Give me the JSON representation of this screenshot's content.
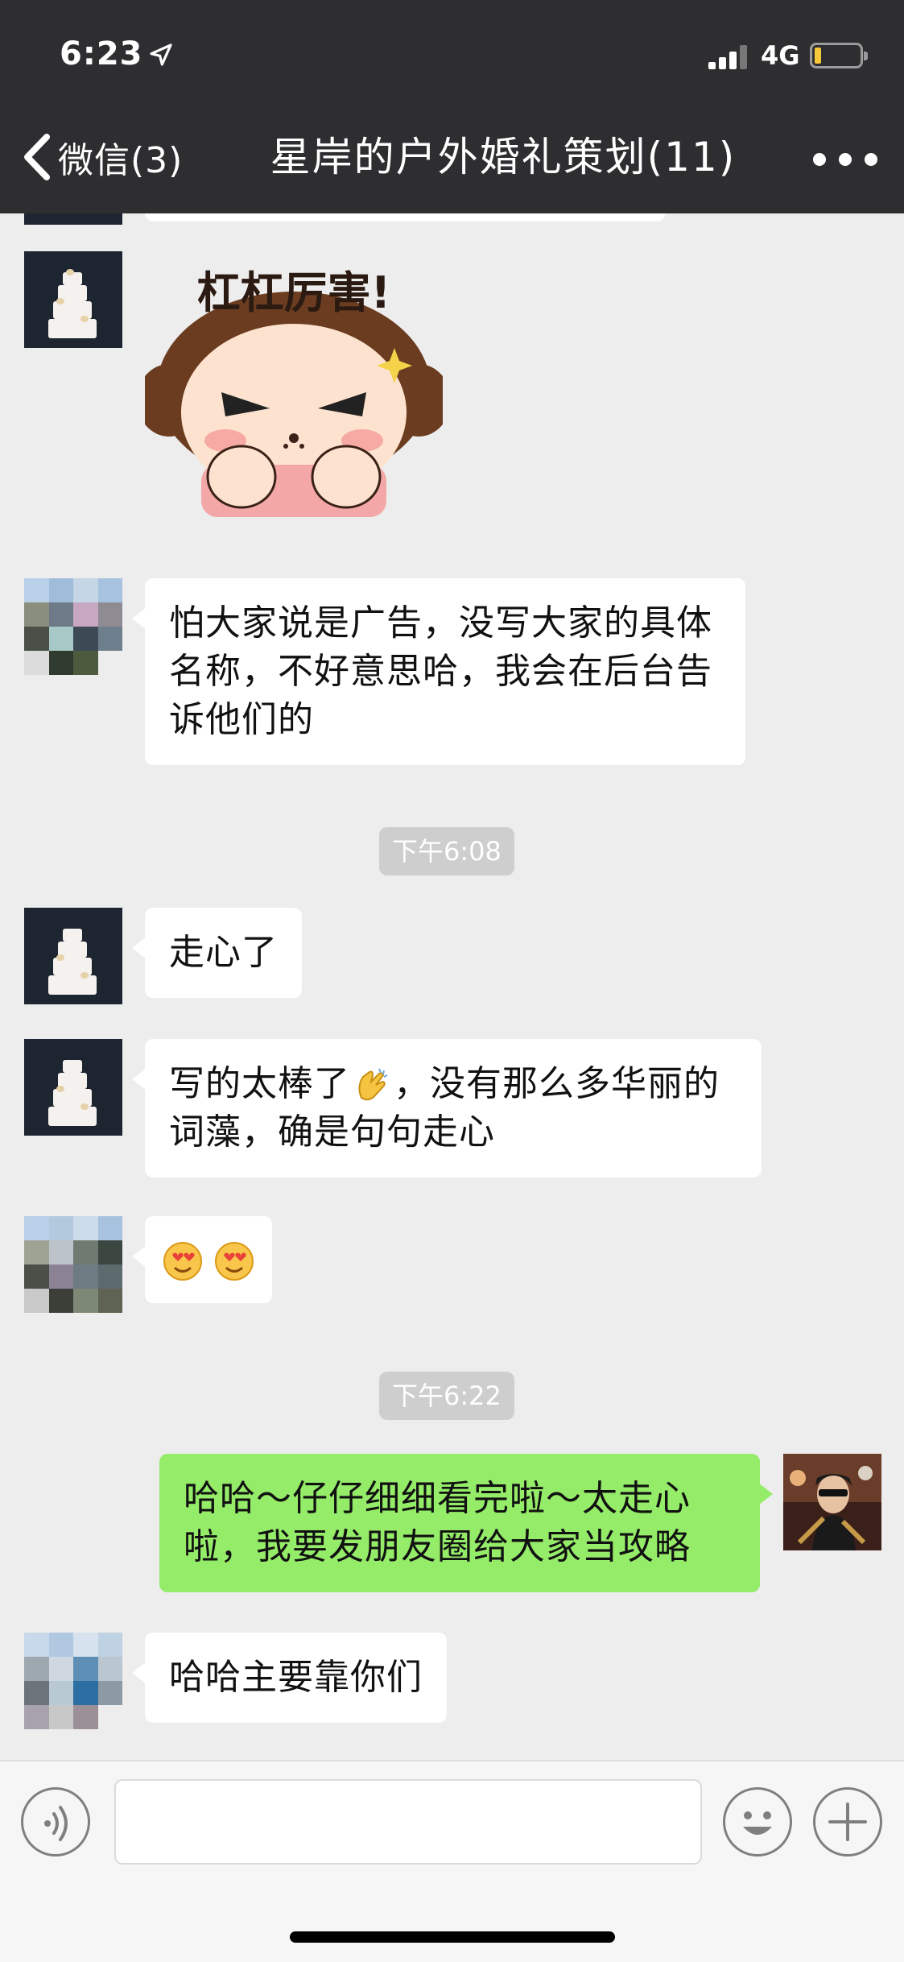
{
  "status_bar": {
    "time": "6:23",
    "network": "4G"
  },
  "nav": {
    "back_label": "微信(3)",
    "title": "星岸的户外婚礼策划(11)"
  },
  "messages": [
    {
      "side": "left",
      "type": "sticker",
      "sticker_text": "杠杠厉害!"
    },
    {
      "side": "left",
      "type": "text",
      "text": "怕大家说是广告，没写大家的具体名称，不好意思哈，我会在后台告诉他们的"
    },
    {
      "type": "timestamp",
      "text": "下午6:08"
    },
    {
      "side": "left",
      "type": "text",
      "text": "走心了"
    },
    {
      "side": "left",
      "type": "text",
      "text_before": "写的太棒了",
      "emoji": "clapping-hands",
      "text_after": "，没有那么多华丽的词藻，确是句句走心"
    },
    {
      "side": "left",
      "type": "emoji",
      "emojis": [
        "smiling-face-with-heart-eyes",
        "smiling-face-with-heart-eyes"
      ]
    },
    {
      "type": "timestamp",
      "text": "下午6:22"
    },
    {
      "side": "right",
      "type": "text",
      "text": "哈哈～仔仔细细看完啦～太走心啦，我要发朋友圈给大家当攻略"
    },
    {
      "side": "left",
      "type": "text",
      "text": "哈哈主要靠你们"
    }
  ],
  "input_bar": {
    "value": "",
    "icons": [
      "voice-icon",
      "emoji-icon",
      "plus-icon"
    ]
  },
  "colors": {
    "header_bg": "#2e2e31",
    "chat_bg": "#ededed",
    "sent_bubble": "#95ec69",
    "received_bubble": "#ffffff",
    "timestamp_pill": "#cecece"
  }
}
